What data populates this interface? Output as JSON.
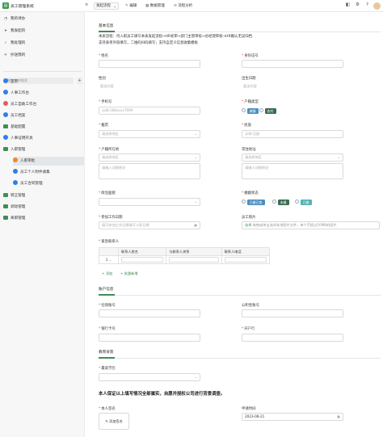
{
  "app": {
    "logo_char": "▤",
    "name": "员工管理系统"
  },
  "topbar": {
    "collapse_icon": "sidebar-collapse-icon",
    "mode_select": "发起流程",
    "links": [
      {
        "icon": "edit-icon",
        "glyph": "✎",
        "label": "编辑"
      },
      {
        "icon": "data-icon",
        "glyph": "▦",
        "label": "数据管理"
      },
      {
        "icon": "flow-icon",
        "glyph": "⟲",
        "label": "流程分析"
      }
    ],
    "right_icons": [
      {
        "name": "record-icon",
        "glyph": "◧"
      },
      {
        "name": "settings-icon",
        "glyph": "⚙"
      },
      {
        "name": "help-icon",
        "glyph": "?"
      }
    ]
  },
  "sidebar": {
    "quick": [
      {
        "icon": "todo-icon",
        "glyph": "◔",
        "label": "我的待办"
      },
      {
        "icon": "start-icon",
        "glyph": "➤",
        "label": "我发起的"
      },
      {
        "icon": "done-icon",
        "glyph": "✓",
        "label": "我处理的"
      },
      {
        "icon": "cc-icon",
        "glyph": "✈",
        "label": "抄送我的"
      }
    ],
    "search_placeholder": "输入名称搜索",
    "add_glyph": "+",
    "nav": [
      {
        "label": "首页",
        "kind": "dot",
        "color": "#2f7fe6"
      },
      {
        "label": "人事工作台",
        "kind": "dot",
        "color": "#2f7fe6"
      },
      {
        "label": "员工自助工作台",
        "kind": "dot",
        "color": "#e65b5b"
      },
      {
        "label": "员工档案",
        "kind": "dot",
        "color": "#2f7fe6"
      },
      {
        "label": "基础配置",
        "kind": "fold"
      },
      {
        "label": "人事证明开具",
        "kind": "dot",
        "color": "#2f7fe6"
      },
      {
        "label": "入职管理",
        "kind": "fold"
      },
      {
        "label": "入职审批",
        "kind": "dot",
        "color": "#f08a2a",
        "sub": true,
        "active": true
      },
      {
        "label": "员工个人附件收集",
        "kind": "dot",
        "color": "#2f7fe6",
        "sub": true
      },
      {
        "label": "员工合同管理",
        "kind": "dot",
        "color": "#2f7fe6",
        "sub": true
      },
      {
        "label": "转正管理",
        "kind": "fold"
      },
      {
        "label": "调动管理",
        "kind": "fold"
      },
      {
        "label": "离职管理",
        "kind": "fold"
      }
    ]
  },
  "form": {
    "sections": {
      "basic": "基本信息",
      "account": "账户信息",
      "education": "教育背景"
    },
    "flow_text": "本表流程：待入职员工填写本表发起流程→HR初审→部门主管审核→总经理审核→HR确认无误归档",
    "flow_note": "支持表单外链填写，二维码扫码填写；支持自定义信息收集模板",
    "name": {
      "label": "姓名",
      "required": true,
      "value": ""
    },
    "id_card": {
      "label": "身份证号",
      "required": true,
      "value": ""
    },
    "gender": {
      "label": "性别",
      "value": "暂无内容"
    },
    "birth": {
      "label": "出生日期",
      "value": "暂无内容"
    },
    "phone": {
      "label": "手机号",
      "required": true,
      "placeholder": "示例:188xxxx7699"
    },
    "hukou_type": {
      "label": "户籍类型",
      "required": true,
      "options": [
        "城镇",
        "农村"
      ]
    },
    "native": {
      "label": "籍贯",
      "required": true,
      "placeholder": "请选择地区"
    },
    "ethnic": {
      "label": "民族",
      "required": true,
      "placeholder": "示例:汉族"
    },
    "hukou_addr": {
      "label": "户籍所在地",
      "required": true,
      "select_placeholder": "请选择地区",
      "detail_placeholder": "请输入详细地址"
    },
    "cur_addr": {
      "label": "常住地址",
      "select_placeholder": "请选择地区",
      "detail_placeholder": "请输入详细地址"
    },
    "politics": {
      "label": "政治面貌",
      "required": true,
      "value": ""
    },
    "marital": {
      "label": "婚姻状态",
      "required": true,
      "options": [
        {
          "label": "已婚已育",
          "bg": "#4a8ec2"
        },
        {
          "label": "未婚",
          "bg": "#3a6b52"
        },
        {
          "label": "已婚",
          "bg": "#4fb3b3"
        }
      ]
    },
    "work_start": {
      "label": "参加工作日期",
      "required": true,
      "placeholder": "填写参加工作日期填写入职日期"
    },
    "photo": {
      "label": "员工照片",
      "button": "选择",
      "hint": "拖拽或单击选择本地图片文件，单个不超过50MB的图片"
    },
    "emergency": {
      "label": "紧急联系人",
      "required": true,
      "columns": [
        "联系人姓名",
        "与联系人关系",
        "联系人电话"
      ],
      "row_no": "1",
      "add": "+ 添加",
      "bulk_add": "+ 批量新增"
    },
    "social": {
      "label": "社保账号",
      "required": true
    },
    "fund": {
      "label": "公积金账号"
    },
    "bank_card": {
      "label": "银行卡号",
      "required": true
    },
    "bank": {
      "label": "开户行",
      "required": true
    },
    "degree": {
      "label": "最高学历",
      "required": true
    },
    "declaration": "本人保证以上填写情况全部属实，自愿并授权公司进行背景调查。",
    "signature": {
      "label": "本人签名",
      "required": true,
      "button": "添加签名"
    },
    "apply_time": {
      "label": "申请时间",
      "value": "2023-08-21"
    }
  },
  "colors": {
    "accent": "#3e8e55"
  }
}
